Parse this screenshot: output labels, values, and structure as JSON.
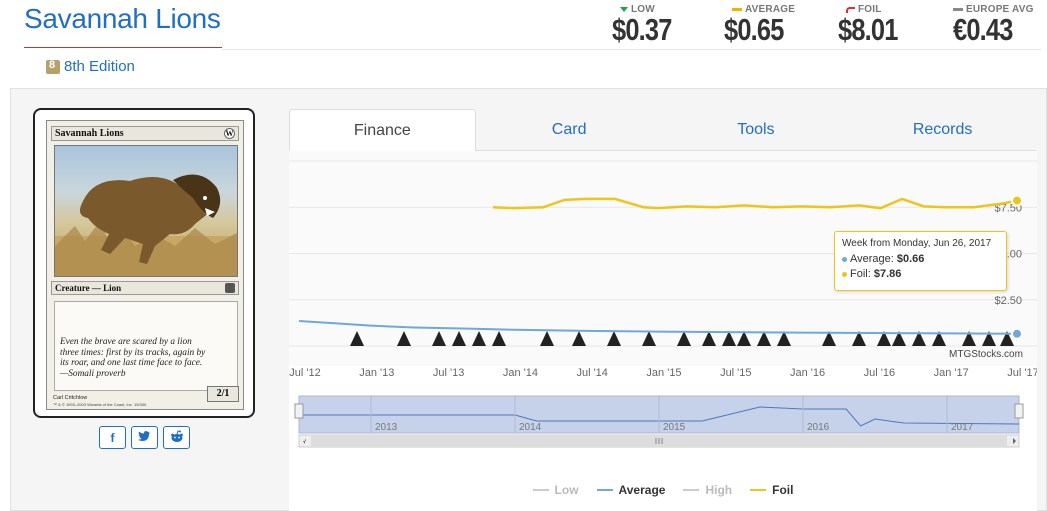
{
  "header": {
    "card_name": "Savannah Lions",
    "set_name": "8th Edition",
    "prices": [
      {
        "label": "LOW",
        "value": "$0.37",
        "color": "#1fa34a",
        "marker": "triangle-down-icon"
      },
      {
        "label": "AVERAGE",
        "value": "$0.65",
        "color": "#f0b400",
        "marker": "dash-icon"
      },
      {
        "label": "FOIL",
        "value": "$8.01",
        "color": "#d33333",
        "marker": "foil-icon"
      },
      {
        "label": "EUROPE AVG",
        "value": "€0.43",
        "color": "#888888",
        "marker": "dash-icon"
      }
    ]
  },
  "card": {
    "name": "Savannah Lions",
    "mana": "W",
    "type_line": "Creature — Lion",
    "flavor": [
      "Even the brave are scared by a lion",
      "three times: first by its tracks, again by",
      "its roar, and one last time face to face.",
      "—Somali proverb"
    ],
    "pt": "2/1",
    "artist": "Carl Critchlow",
    "copyright": "™ & © 1993–2003 Wizards of the Coast, Inc. 15/350"
  },
  "share": [
    {
      "name": "facebook",
      "glyph": "f"
    },
    {
      "name": "twitter",
      "glyph": "t"
    },
    {
      "name": "reddit",
      "glyph": "r"
    }
  ],
  "tabs": [
    {
      "label": "Finance",
      "active": true
    },
    {
      "label": "Card",
      "active": false
    },
    {
      "label": "Tools",
      "active": false
    },
    {
      "label": "Records",
      "active": false
    }
  ],
  "tooltip": {
    "header": "Week from Monday, Jun 26, 2017",
    "average_label": "Average:",
    "average_value": "$0.66",
    "foil_label": "Foil:",
    "foil_value": "$7.86"
  },
  "watermark": "MTGStocks.com",
  "colors": {
    "average": "#6fa8dc",
    "foil": "#f0c419",
    "low": "#cccccc",
    "high": "#cccccc",
    "link": "#1f6fc4"
  },
  "chart_data": {
    "type": "line",
    "x_ticks": [
      "Jul '12",
      "Jan '13",
      "Jul '13",
      "Jan '14",
      "Jul '14",
      "Jan '15",
      "Jul '15",
      "Jan '16",
      "Jul '16",
      "Jan '17",
      "Jul '17"
    ],
    "y_ticks": [
      "$2.50",
      "5.00",
      "$7.50"
    ],
    "y_tick_values": [
      2.5,
      5.0,
      7.5
    ],
    "ylim": [
      0,
      10
    ],
    "xlim": [
      2012.5,
      2017.5
    ],
    "legend": [
      "Low",
      "Average",
      "High",
      "Foil"
    ],
    "legend_placement": "bottom-center",
    "grid": true,
    "series": [
      {
        "name": "Average",
        "x": [
          2012.5,
          2012.8,
          2013.0,
          2013.3,
          2013.6,
          2014.0,
          2014.5,
          2015.0,
          2015.5,
          2016.0,
          2016.5,
          2017.0,
          2017.5
        ],
        "values": [
          1.35,
          1.2,
          1.1,
          1.0,
          0.95,
          0.88,
          0.82,
          0.78,
          0.75,
          0.72,
          0.7,
          0.68,
          0.66
        ]
      },
      {
        "name": "Foil",
        "x": [
          2013.85,
          2014.0,
          2014.2,
          2014.35,
          2014.5,
          2014.7,
          2014.9,
          2015.0,
          2015.2,
          2015.4,
          2015.6,
          2015.8,
          2016.0,
          2016.2,
          2016.4,
          2016.55,
          2016.7,
          2016.85,
          2017.0,
          2017.2,
          2017.4,
          2017.5
        ],
        "values": [
          7.5,
          7.45,
          7.5,
          7.9,
          7.95,
          7.95,
          7.5,
          7.45,
          7.55,
          7.5,
          7.6,
          7.5,
          7.55,
          7.5,
          7.6,
          7.45,
          7.95,
          7.55,
          7.5,
          7.5,
          7.7,
          7.86
        ]
      }
    ],
    "navigator_labels": [
      "2013",
      "2014",
      "2015",
      "2016",
      "2017"
    ],
    "navigator_values": [
      2013,
      2014,
      2015,
      2016,
      2017
    ]
  },
  "legend_items": [
    {
      "label": "Low",
      "color": "#cccccc",
      "text_color": "#bbbbbb"
    },
    {
      "label": "Average",
      "color": "#6fa8dc",
      "text_color": "#333333"
    },
    {
      "label": "High",
      "color": "#cccccc",
      "text_color": "#bbbbbb"
    },
    {
      "label": "Foil",
      "color": "#f0c419",
      "text_color": "#333333"
    }
  ]
}
